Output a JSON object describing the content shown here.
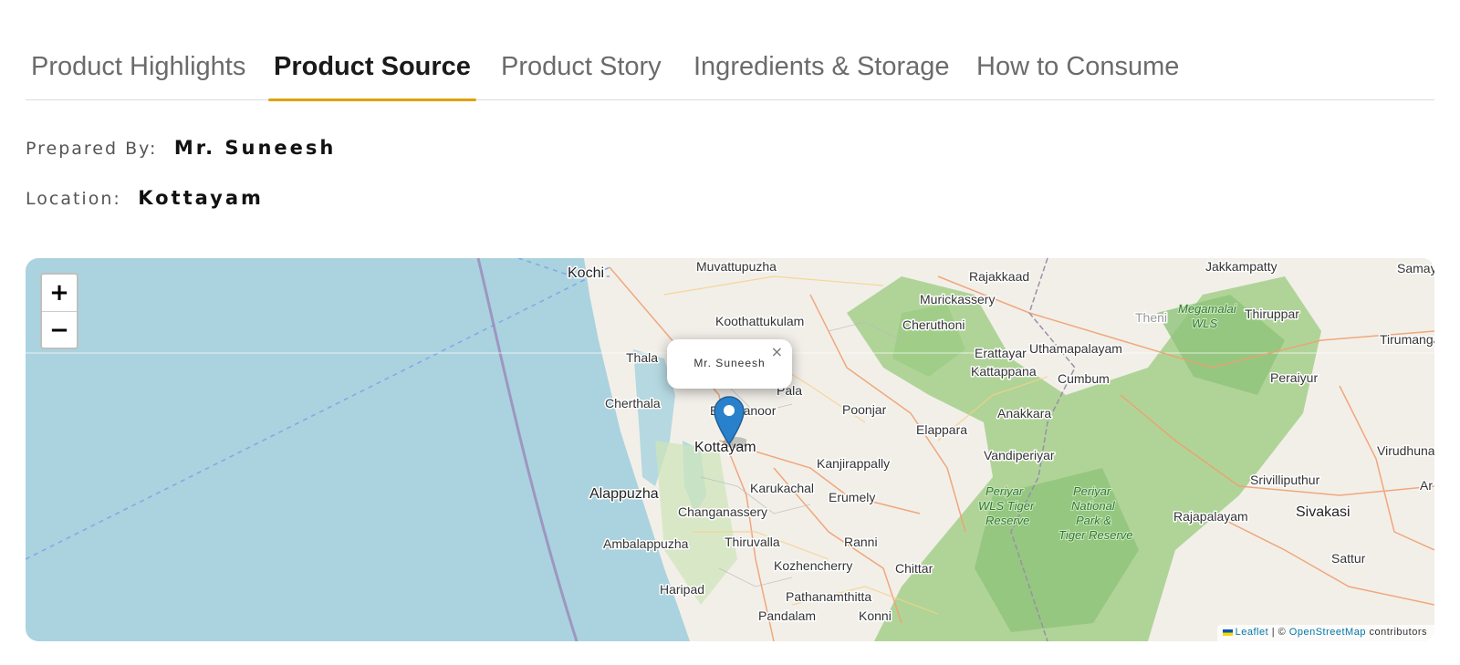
{
  "colors": {
    "accent": "#e0a100",
    "sea": "#aad3df",
    "land": "#f2efe9",
    "forest": "#a8d08f",
    "marker": "#2a81cb"
  },
  "tabs": [
    {
      "label": "Product Highlights",
      "active": false
    },
    {
      "label": "Product Source",
      "active": true
    },
    {
      "label": "Product Story",
      "active": false
    },
    {
      "label": "Ingredients & Storage",
      "active": false
    },
    {
      "label": "How to Consume",
      "active": false
    }
  ],
  "source": {
    "prepared_by_label": "Prepared By:",
    "prepared_by_value": "Mr. Suneesh",
    "location_label": "Location:",
    "location_value": "Kottayam"
  },
  "map": {
    "zoom_in_label": "+",
    "zoom_out_label": "−",
    "popup_text": "Mr. Suneesh",
    "popup_close": "×",
    "marker_icon": "map-marker-icon",
    "places": {
      "kochi": "Kochi",
      "muvattupuzha": "Muvattupuzha",
      "rajakkaad": "Rajakkaad",
      "jakkampatty": "Jakkampatty",
      "samay": "Samay",
      "murickassery": "Murickassery",
      "koothattukulam": "Koothattukulam",
      "cheruthoni": "Cheruthoni",
      "theni": "Theni",
      "thiruppar": "Thiruppar",
      "uthamapalayam": "Uthamapalayam",
      "tirumanga": "Tirumanga",
      "thala": "Thala",
      "erattayar": "Erattayar",
      "kattappana": "Kattappana",
      "cumbum": "Cumbum",
      "peraiyur": "Peraiyur",
      "pala": "Pala",
      "cherthala": "Cherthala",
      "ettumanoor": "Ettumanoor",
      "poonjar": "Poonjar",
      "anakkara": "Anakkara",
      "elappara": "Elappara",
      "kottayam": "Kottayam",
      "kanjirappally": "Kanjirappally",
      "vandiperiyar": "Vandiperiyar",
      "virudhunagar": "Virudhunaga",
      "alappuzha": "Alappuzha",
      "karukachal": "Karukachal",
      "srivilliputhur": "Srivilliputhur",
      "ar": "Ar",
      "changanassery": "Changanassery",
      "erumely": "Erumely",
      "rajapalayam": "Rajapalayam",
      "sivakasi": "Sivakasi",
      "ambalappuzha": "Ambalappuzha",
      "thiruvalla": "Thiruvalla",
      "ranni": "Ranni",
      "sattur": "Sattur",
      "kozhencherry": "Kozhencherry",
      "chittar": "Chittar",
      "haripad": "Haripad",
      "pathanamthitta": "Pathanamthitta",
      "pandalam": "Pandalam",
      "konni": "Konni",
      "megamalai": "Megamalai",
      "wls": "WLS",
      "periyar_wls_1": "Periyar",
      "periyar_wls_2": "WLS Tiger",
      "periyar_wls_3": "Reserve",
      "periyar_np_1": "Periyar",
      "periyar_np_2": "National",
      "periyar_np_3": "Park &",
      "periyar_np_4": "Tiger Reserve"
    },
    "attribution": {
      "leaflet": "Leaflet",
      "separator": "| ©",
      "osm": "OpenStreetMap",
      "suffix": "contributors"
    }
  }
}
